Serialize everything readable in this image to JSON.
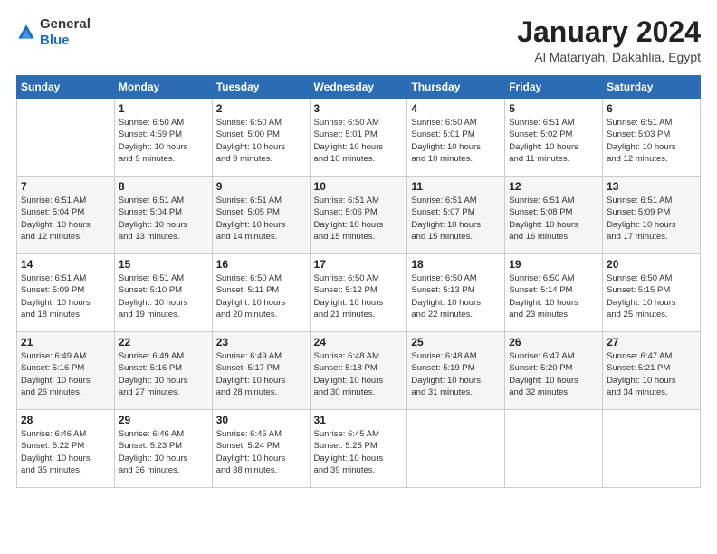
{
  "logo": {
    "general": "General",
    "blue": "Blue"
  },
  "title": "January 2024",
  "subtitle": "Al Matariyah, Dakahlia, Egypt",
  "weekdays": [
    "Sunday",
    "Monday",
    "Tuesday",
    "Wednesday",
    "Thursday",
    "Friday",
    "Saturday"
  ],
  "weeks": [
    [
      {
        "day": "",
        "info": ""
      },
      {
        "day": "1",
        "info": "Sunrise: 6:50 AM\nSunset: 4:59 PM\nDaylight: 10 hours\nand 9 minutes."
      },
      {
        "day": "2",
        "info": "Sunrise: 6:50 AM\nSunset: 5:00 PM\nDaylight: 10 hours\nand 9 minutes."
      },
      {
        "day": "3",
        "info": "Sunrise: 6:50 AM\nSunset: 5:01 PM\nDaylight: 10 hours\nand 10 minutes."
      },
      {
        "day": "4",
        "info": "Sunrise: 6:50 AM\nSunset: 5:01 PM\nDaylight: 10 hours\nand 10 minutes."
      },
      {
        "day": "5",
        "info": "Sunrise: 6:51 AM\nSunset: 5:02 PM\nDaylight: 10 hours\nand 11 minutes."
      },
      {
        "day": "6",
        "info": "Sunrise: 6:51 AM\nSunset: 5:03 PM\nDaylight: 10 hours\nand 12 minutes."
      }
    ],
    [
      {
        "day": "7",
        "info": "Sunrise: 6:51 AM\nSunset: 5:04 PM\nDaylight: 10 hours\nand 12 minutes."
      },
      {
        "day": "8",
        "info": "Sunrise: 6:51 AM\nSunset: 5:04 PM\nDaylight: 10 hours\nand 13 minutes."
      },
      {
        "day": "9",
        "info": "Sunrise: 6:51 AM\nSunset: 5:05 PM\nDaylight: 10 hours\nand 14 minutes."
      },
      {
        "day": "10",
        "info": "Sunrise: 6:51 AM\nSunset: 5:06 PM\nDaylight: 10 hours\nand 15 minutes."
      },
      {
        "day": "11",
        "info": "Sunrise: 6:51 AM\nSunset: 5:07 PM\nDaylight: 10 hours\nand 15 minutes."
      },
      {
        "day": "12",
        "info": "Sunrise: 6:51 AM\nSunset: 5:08 PM\nDaylight: 10 hours\nand 16 minutes."
      },
      {
        "day": "13",
        "info": "Sunrise: 6:51 AM\nSunset: 5:09 PM\nDaylight: 10 hours\nand 17 minutes."
      }
    ],
    [
      {
        "day": "14",
        "info": "Sunrise: 6:51 AM\nSunset: 5:09 PM\nDaylight: 10 hours\nand 18 minutes."
      },
      {
        "day": "15",
        "info": "Sunrise: 6:51 AM\nSunset: 5:10 PM\nDaylight: 10 hours\nand 19 minutes."
      },
      {
        "day": "16",
        "info": "Sunrise: 6:50 AM\nSunset: 5:11 PM\nDaylight: 10 hours\nand 20 minutes."
      },
      {
        "day": "17",
        "info": "Sunrise: 6:50 AM\nSunset: 5:12 PM\nDaylight: 10 hours\nand 21 minutes."
      },
      {
        "day": "18",
        "info": "Sunrise: 6:50 AM\nSunset: 5:13 PM\nDaylight: 10 hours\nand 22 minutes."
      },
      {
        "day": "19",
        "info": "Sunrise: 6:50 AM\nSunset: 5:14 PM\nDaylight: 10 hours\nand 23 minutes."
      },
      {
        "day": "20",
        "info": "Sunrise: 6:50 AM\nSunset: 5:15 PM\nDaylight: 10 hours\nand 25 minutes."
      }
    ],
    [
      {
        "day": "21",
        "info": "Sunrise: 6:49 AM\nSunset: 5:16 PM\nDaylight: 10 hours\nand 26 minutes."
      },
      {
        "day": "22",
        "info": "Sunrise: 6:49 AM\nSunset: 5:16 PM\nDaylight: 10 hours\nand 27 minutes."
      },
      {
        "day": "23",
        "info": "Sunrise: 6:49 AM\nSunset: 5:17 PM\nDaylight: 10 hours\nand 28 minutes."
      },
      {
        "day": "24",
        "info": "Sunrise: 6:48 AM\nSunset: 5:18 PM\nDaylight: 10 hours\nand 30 minutes."
      },
      {
        "day": "25",
        "info": "Sunrise: 6:48 AM\nSunset: 5:19 PM\nDaylight: 10 hours\nand 31 minutes."
      },
      {
        "day": "26",
        "info": "Sunrise: 6:47 AM\nSunset: 5:20 PM\nDaylight: 10 hours\nand 32 minutes."
      },
      {
        "day": "27",
        "info": "Sunrise: 6:47 AM\nSunset: 5:21 PM\nDaylight: 10 hours\nand 34 minutes."
      }
    ],
    [
      {
        "day": "28",
        "info": "Sunrise: 6:46 AM\nSunset: 5:22 PM\nDaylight: 10 hours\nand 35 minutes."
      },
      {
        "day": "29",
        "info": "Sunrise: 6:46 AM\nSunset: 5:23 PM\nDaylight: 10 hours\nand 36 minutes."
      },
      {
        "day": "30",
        "info": "Sunrise: 6:45 AM\nSunset: 5:24 PM\nDaylight: 10 hours\nand 38 minutes."
      },
      {
        "day": "31",
        "info": "Sunrise: 6:45 AM\nSunset: 5:25 PM\nDaylight: 10 hours\nand 39 minutes."
      },
      {
        "day": "",
        "info": ""
      },
      {
        "day": "",
        "info": ""
      },
      {
        "day": "",
        "info": ""
      }
    ]
  ]
}
